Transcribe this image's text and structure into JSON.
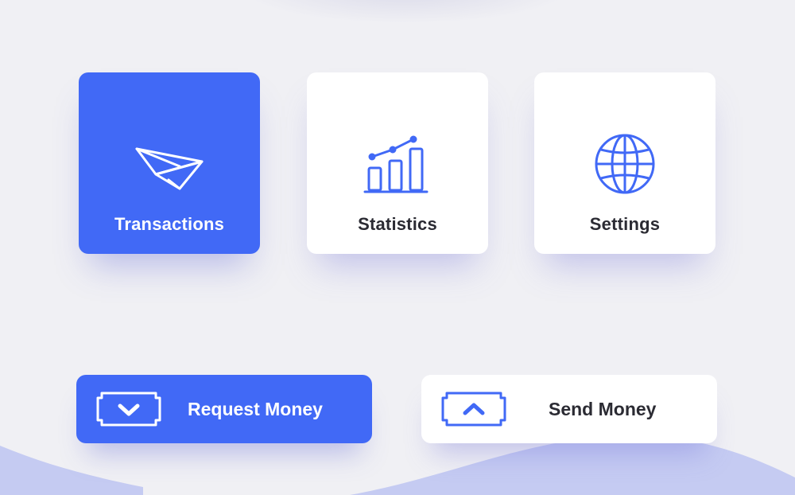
{
  "colors": {
    "accent": "#4169f6",
    "background": "#f0f0f4",
    "card": "#ffffff",
    "text_dark": "#2b2b33",
    "wave": "#c5cbf2"
  },
  "menu": {
    "items": [
      {
        "label": "Transactions",
        "icon": "paper-plane-icon",
        "active": true
      },
      {
        "label": "Statistics",
        "icon": "bar-chart-icon",
        "active": false
      },
      {
        "label": "Settings",
        "icon": "globe-icon",
        "active": false
      }
    ]
  },
  "actions": {
    "request": {
      "label": "Request Money",
      "icon": "money-bill-down-icon"
    },
    "send": {
      "label": "Send Money",
      "icon": "money-bill-up-icon"
    }
  }
}
